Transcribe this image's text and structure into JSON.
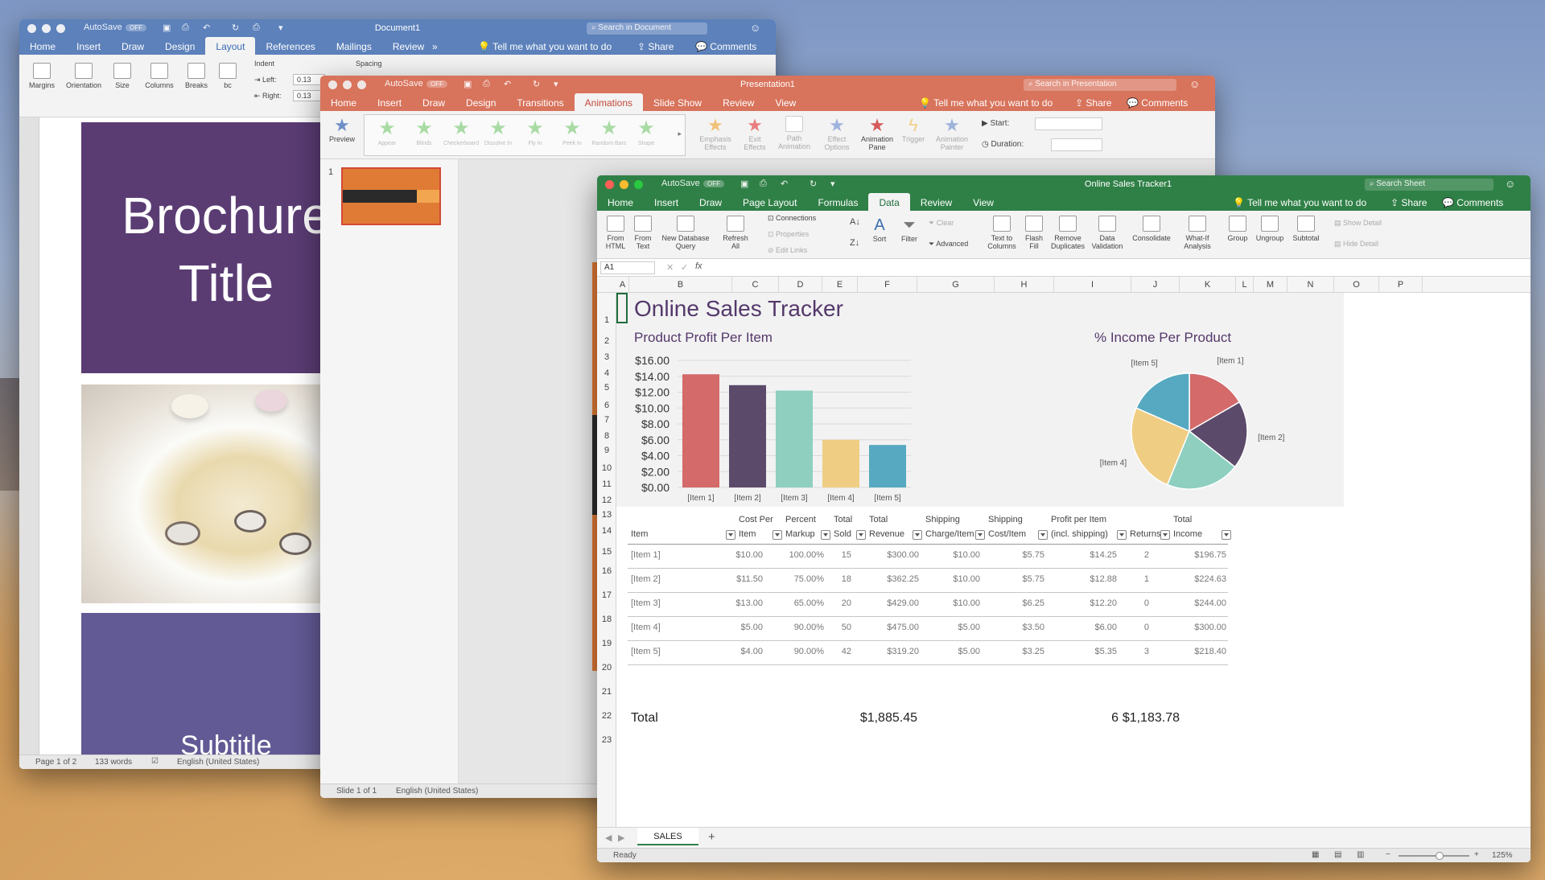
{
  "word": {
    "autosave": "AutoSave",
    "autosave_state": "OFF",
    "title": "Document1",
    "search_placeholder": "Search in Document",
    "tabs": [
      "Home",
      "Insert",
      "Draw",
      "Design",
      "Layout",
      "References",
      "Mailings",
      "Review"
    ],
    "active_tab": "Layout",
    "more": "»",
    "tellme": "Tell me what you want to do",
    "share": "Share",
    "comments": "Comments",
    "ribbon": {
      "margins": "Margins",
      "orientation": "Orientation",
      "size": "Size",
      "columns": "Columns",
      "breaks": "Breaks",
      "hyph": "bc",
      "indent": "Indent",
      "spacing": "Spacing",
      "left": "Left:",
      "right": "Right:",
      "left_val": "0.13",
      "right_val": "0.13"
    },
    "page": {
      "title_line1": "Brochure",
      "title_line2": "Title",
      "subtitle": "Subtitle"
    },
    "status": {
      "page": "Page 1 of 2",
      "words": "133 words",
      "lang": "English (United States)"
    }
  },
  "ppt": {
    "autosave": "AutoSave",
    "autosave_state": "OFF",
    "title": "Presentation1",
    "search_placeholder": "Search in Presentation",
    "tabs": [
      "Home",
      "Insert",
      "Draw",
      "Design",
      "Transitions",
      "Animations",
      "Slide Show",
      "Review",
      "View"
    ],
    "active_tab": "Animations",
    "tellme": "Tell me what you want to do",
    "share": "Share",
    "comments": "Comments",
    "ribbon": {
      "preview": "Preview",
      "effects": [
        "Appear",
        "Blinds",
        "Checkerboard",
        "Dissolve In",
        "Fly In",
        "Peek In",
        "Random Bars",
        "Shape"
      ],
      "emphasis": "Emphasis Effects",
      "exit": "Exit Effects",
      "path": "Path Animation",
      "effect_options": "Effect Options",
      "animation_pane": "Animation Pane",
      "trigger": "Trigger",
      "animation_painter": "Animation Painter",
      "start": "Start:",
      "duration": "Duration:"
    },
    "thumb_num": "1",
    "status": {
      "slide": "Slide 1 of 1",
      "lang": "English (United States)"
    }
  },
  "excel": {
    "autosave": "AutoSave",
    "autosave_state": "OFF",
    "title": "Online Sales Tracker1",
    "search_placeholder": "Search Sheet",
    "tabs": [
      "Home",
      "Insert",
      "Draw",
      "Page Layout",
      "Formulas",
      "Data",
      "Review",
      "View"
    ],
    "active_tab": "Data",
    "tellme": "Tell me what you want to do",
    "share": "Share",
    "comments": "Comments",
    "ribbon": {
      "from_html": "From HTML",
      "from_text": "From Text",
      "new_db_query": "New Database Query",
      "refresh_all": "Refresh All",
      "connections": "Connections",
      "properties": "Properties",
      "edit_links": "Edit Links",
      "sort": "Sort",
      "filter": "Filter",
      "clear": "Clear",
      "advanced": "Advanced",
      "text_to_columns": "Text to Columns",
      "flash_fill": "Flash Fill",
      "remove_duplicates": "Remove Duplicates",
      "data_validation": "Data Validation",
      "consolidate": "Consolidate",
      "what_if": "What-If Analysis",
      "group": "Group",
      "ungroup": "Ungroup",
      "subtotal": "Subtotal",
      "show_detail": "Show Detail",
      "hide_detail": "Hide Detail"
    },
    "name_box": "A1",
    "fx": "fx",
    "columns": [
      "A",
      "B",
      "C",
      "D",
      "E",
      "F",
      "G",
      "H",
      "I",
      "J",
      "K",
      "L",
      "M",
      "N",
      "O",
      "P"
    ],
    "rows": [
      "1",
      "2",
      "3",
      "4",
      "5",
      "6",
      "7",
      "8",
      "9",
      "10",
      "11",
      "12",
      "13",
      "14",
      "15",
      "16",
      "17",
      "18",
      "19",
      "20",
      "21",
      "22",
      "23"
    ],
    "sheet_title": "Online Sales Tracker",
    "bar_title": "Product Profit Per Item",
    "pie_title": "% Income Per Product",
    "table_headers": {
      "item": "Item",
      "cost_per_1": "Cost Per",
      "cost_per_2": "Item",
      "percent_1": "Percent",
      "percent_2": "Markup",
      "total_sold_1": "Total",
      "total_sold_2": "Sold",
      "total_rev_1": "Total",
      "total_rev_2": "Revenue",
      "ship_charge_1": "Shipping",
      "ship_charge_2": "Charge/Item",
      "ship_cost_1": "Shipping",
      "ship_cost_2": "Cost/Item",
      "profit_1": "Profit per Item",
      "profit_2": "(incl. shipping)",
      "returns": "Returns",
      "total_income_1": "Total",
      "total_income_2": "Income"
    },
    "table_rows": [
      {
        "item": "[Item 1]",
        "cost": "$10.00",
        "markup": "100.00%",
        "sold": "15",
        "revenue": "$300.00",
        "ship_charge": "$10.00",
        "ship_cost": "$5.75",
        "profit": "$14.25",
        "returns": "2",
        "income": "$196.75"
      },
      {
        "item": "[Item 2]",
        "cost": "$11.50",
        "markup": "75.00%",
        "sold": "18",
        "revenue": "$362.25",
        "ship_charge": "$10.00",
        "ship_cost": "$5.75",
        "profit": "$12.88",
        "returns": "1",
        "income": "$224.63"
      },
      {
        "item": "[Item 3]",
        "cost": "$13.00",
        "markup": "65.00%",
        "sold": "20",
        "revenue": "$429.00",
        "ship_charge": "$10.00",
        "ship_cost": "$6.25",
        "profit": "$12.20",
        "returns": "0",
        "income": "$244.00"
      },
      {
        "item": "[Item 4]",
        "cost": "$5.00",
        "markup": "90.00%",
        "sold": "50",
        "revenue": "$475.00",
        "ship_charge": "$5.00",
        "ship_cost": "$3.50",
        "profit": "$6.00",
        "returns": "0",
        "income": "$300.00"
      },
      {
        "item": "[Item 5]",
        "cost": "$4.00",
        "markup": "90.00%",
        "sold": "42",
        "revenue": "$319.20",
        "ship_charge": "$5.00",
        "ship_cost": "$3.25",
        "profit": "$5.35",
        "returns": "3",
        "income": "$218.40"
      }
    ],
    "totals": {
      "label": "Total",
      "revenue": "$1,885.45",
      "returns": "6",
      "income": "$1,183.78"
    },
    "sheet_tab": "SALES",
    "add_sheet": "+",
    "status": {
      "ready": "Ready",
      "zoom": "125%"
    }
  },
  "chart_data": [
    {
      "type": "bar",
      "title": "Product Profit Per Item",
      "categories": [
        "[Item 1]",
        "[Item 2]",
        "[Item 3]",
        "[Item 4]",
        "[Item 5]"
      ],
      "values": [
        14.25,
        12.88,
        12.2,
        6.0,
        5.35
      ],
      "yticks": [
        "$0.00",
        "$2.00",
        "$4.00",
        "$6.00",
        "$8.00",
        "$10.00",
        "$12.00",
        "$14.00",
        "$16.00"
      ],
      "ylim": [
        0,
        16
      ],
      "grid": true,
      "colors": [
        "#d46a6a",
        "#5c4a6b",
        "#8ecfc0",
        "#efcd83",
        "#56a9c0"
      ]
    },
    {
      "type": "pie",
      "title": "% Income Per Product",
      "categories": [
        "[Item 1]",
        "[Item 2]",
        "[Item 3]",
        "[Item 4]",
        "[Item 5]"
      ],
      "values": [
        196.75,
        224.63,
        244.0,
        300.0,
        218.4
      ],
      "colors": [
        "#d46a6a",
        "#5c4a6b",
        "#8ecfc0",
        "#efcd83",
        "#56a9c0"
      ]
    }
  ]
}
